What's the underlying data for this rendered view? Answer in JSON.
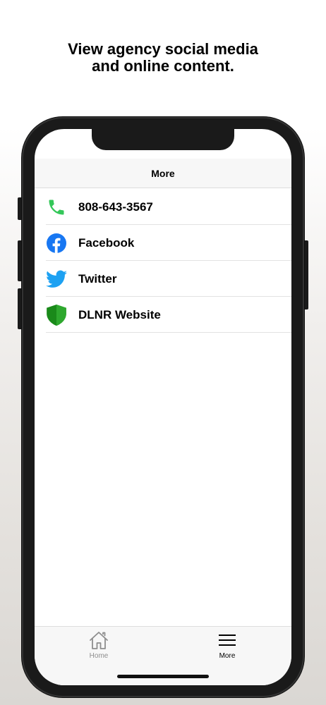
{
  "promo": {
    "line1": "View agency social media",
    "line2": "and online content."
  },
  "navbar": {
    "title": "More"
  },
  "items": [
    {
      "label": "808-643-3567",
      "icon": "phone-icon",
      "color": "#34c759"
    },
    {
      "label": "Facebook",
      "icon": "facebook-icon",
      "color": "#1877f2"
    },
    {
      "label": "Twitter",
      "icon": "twitter-icon",
      "color": "#1da1f2"
    },
    {
      "label": "DLNR Website",
      "icon": "shield-icon",
      "color": "#1a8a1a"
    }
  ],
  "tabbar": {
    "tabs": [
      {
        "label": "Home",
        "icon": "home-icon",
        "active": false
      },
      {
        "label": "More",
        "icon": "menu-icon",
        "active": true
      }
    ]
  }
}
